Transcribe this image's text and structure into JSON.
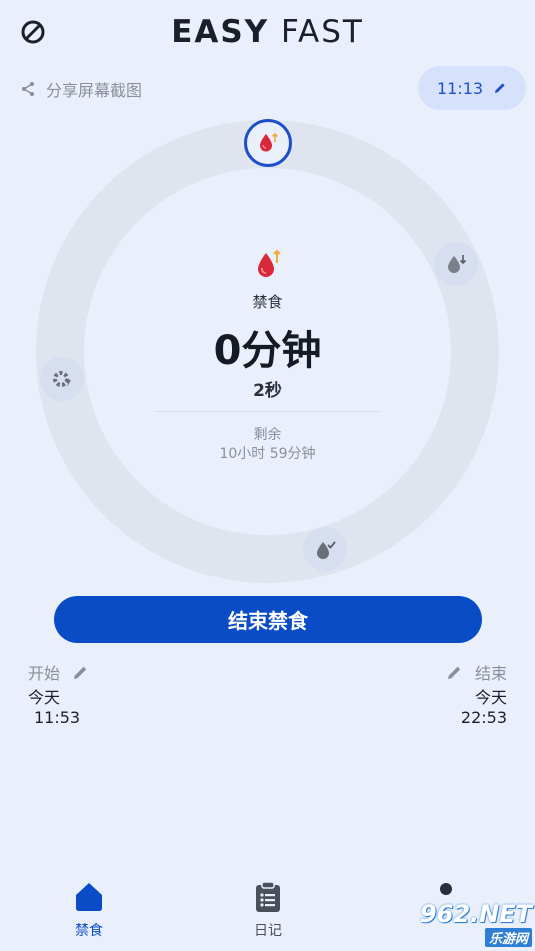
{
  "header": {
    "title_bold": "EASY",
    "title_light": "FAST",
    "share_label": "分享屏幕截图",
    "time_chip": "11:13"
  },
  "timer": {
    "stage_label": "禁食",
    "elapsed": "0分钟",
    "seconds": "2秒",
    "remaining_label": "剩余",
    "remaining_value": "10小时 59分钟",
    "accent_color": "#1e4fc8",
    "ring_color": "#dfe5ef",
    "stages": [
      "blood-sugar-rise-icon",
      "blood-sugar-fall-icon",
      "fat-burning-icon",
      "autophagy-icon"
    ]
  },
  "actions": {
    "end_fast": "结束禁食",
    "button_color": "#0a4cc6"
  },
  "schedule": {
    "start_label": "开始",
    "start_day": "今天",
    "start_time": "11:53",
    "end_label": "结束",
    "end_day": "今天",
    "end_time": "22:53"
  },
  "nav": {
    "items": [
      {
        "label": "禁食",
        "icon": "home-icon",
        "active": true
      },
      {
        "label": "日记",
        "icon": "clipboard-icon",
        "active": false
      }
    ]
  },
  "watermark": {
    "top": "962.NET",
    "bottom": "乐游网"
  }
}
